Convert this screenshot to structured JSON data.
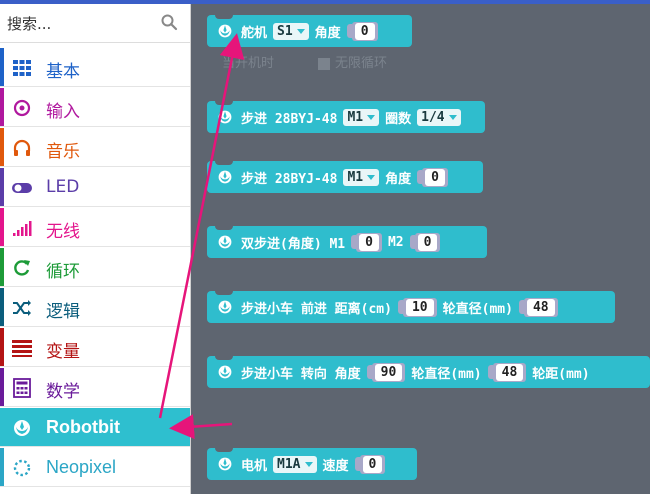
{
  "search": {
    "placeholder": "搜索..."
  },
  "categories": [
    {
      "label": "基本",
      "icon": "grid-icon",
      "color": "#1e62c8"
    },
    {
      "label": "输入",
      "icon": "target-icon",
      "color": "#b0189e"
    },
    {
      "label": "音乐",
      "icon": "headphones-icon",
      "color": "#e0580c"
    },
    {
      "label": "LED",
      "icon": "toggle-icon",
      "color": "#5b3da8"
    },
    {
      "label": "无线",
      "icon": "signal-icon",
      "color": "#e3158c"
    },
    {
      "label": "循环",
      "icon": "refresh-icon",
      "color": "#1d9b38"
    },
    {
      "label": "逻辑",
      "icon": "shuffle-icon",
      "color": "#0b5d7c"
    },
    {
      "label": "变量",
      "icon": "list-icon",
      "color": "#b41414"
    },
    {
      "label": "数学",
      "icon": "calculator-icon",
      "color": "#6a1b9a"
    },
    {
      "label": "Robotbit",
      "icon": "rebel-icon",
      "color": "#2ebfcf",
      "selected": true
    },
    {
      "label": "Neopixel",
      "icon": "ring-icon",
      "color": "#2ba6c6"
    }
  ],
  "ghost": {
    "left": "当开机时",
    "right": "无限循环"
  },
  "blocks": {
    "servo": {
      "label": "舵机",
      "dropdown": "S1",
      "label2": "角度",
      "value": "0"
    },
    "stepper": {
      "label": "步进 28BYJ-48",
      "dropdown": "M1",
      "label2": "圈数",
      "dropdown2": "1/4"
    },
    "stepper_deg": {
      "label": "步进 28BYJ-48",
      "dropdown": "M1",
      "label2": "角度",
      "value": "0"
    },
    "dual": {
      "label": "双步进(角度) M1",
      "value": "0",
      "label2": "M2",
      "value2": "0"
    },
    "car_forward": {
      "label": "步进小车 前进 距离(cm)",
      "value": "10",
      "label2": "轮直径(mm)",
      "value2": "48"
    },
    "car_turn": {
      "label": "步进小车 转向 角度",
      "value": "90",
      "label2": "轮直径(mm)",
      "value2": "48",
      "label3": "轮距(mm)"
    },
    "motor": {
      "label": "电机",
      "dropdown": "M1A",
      "label2": "速度",
      "value": "0"
    }
  },
  "colors": {
    "block": "#2fbdcd",
    "workspace": "#5e6570",
    "arrow": "#e6157a"
  }
}
